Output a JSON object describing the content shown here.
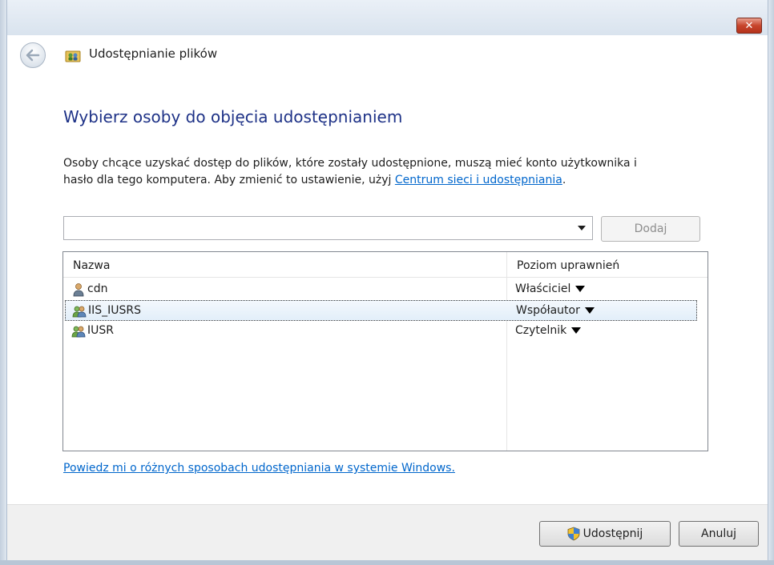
{
  "window": {
    "close_label": "✕",
    "title": "Udostępnianie plików"
  },
  "main": {
    "heading": "Wybierz osoby do objęcia udostępnianiem",
    "description_line1": "Osoby chcące uzyskać dostęp do plików, które zostały udostępnione, muszą mieć konto użytkownika i",
    "description_line2_prefix": "hasło dla tego komputera. Aby zmienić to ustawienie, użyj ",
    "description_link": "Centrum sieci i udostępniania",
    "description_suffix": "."
  },
  "add_user": {
    "combo_value": "",
    "add_button_label": "Dodaj"
  },
  "list": {
    "columns": {
      "name": "Nazwa",
      "permission": "Poziom uprawnień"
    },
    "rows": [
      {
        "name": "cdn",
        "permission": "Właściciel",
        "icon": "user-icon",
        "selected": false
      },
      {
        "name": "IIS_IUSRS",
        "permission": "Współautor",
        "icon": "group-icon",
        "selected": true
      },
      {
        "name": "IUSR",
        "permission": "Czytelnik",
        "icon": "group-icon",
        "selected": false
      }
    ]
  },
  "help_link": "Powiedz mi o różnych sposobach udostępniania w systemie Windows.",
  "footer": {
    "share_label": "Udostępnij",
    "cancel_label": "Anuluj"
  },
  "colors": {
    "heading": "#1e3287",
    "link": "#0066cc",
    "close_button": "#c7452c"
  }
}
